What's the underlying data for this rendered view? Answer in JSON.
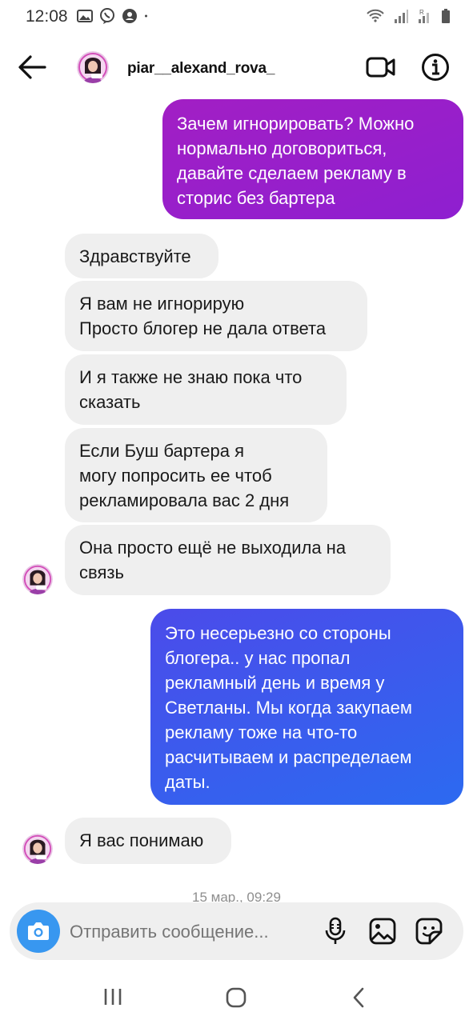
{
  "status_bar": {
    "time": "12:08",
    "left_icons": [
      "gallery-icon",
      "viber-icon",
      "account-icon",
      "dot-icon"
    ],
    "right_icons": [
      "wifi-icon",
      "signal-icon",
      "signal-roaming-icon",
      "battery-icon"
    ]
  },
  "header": {
    "username": "piar__alexand_rova_",
    "icons": [
      "back-arrow-icon",
      "video-call-icon",
      "info-icon"
    ]
  },
  "messages": [
    {
      "from": "me",
      "lines": [
        "Зачем игнорировать? Можно",
        "нормально договориться,",
        "давайте сделаем рекламу в",
        "сторис  без бартера"
      ]
    },
    {
      "from": "them",
      "lines": [
        "Здравствуйте"
      ]
    },
    {
      "from": "them",
      "lines": [
        "Я вам не игнорирую",
        "Просто блогер не дала ответа"
      ]
    },
    {
      "from": "them",
      "lines": [
        "И я также не знаю пока что",
        "сказать"
      ]
    },
    {
      "from": "them",
      "lines": [
        "Если Буш бартера я",
        "могу попросить ее чтоб",
        "рекламировала вас 2 дня"
      ]
    },
    {
      "from": "them",
      "lines": [
        "Она просто ещё не выходила на",
        "связь"
      ]
    },
    {
      "from": "me",
      "lines": [
        "Это несерьезно со стороны",
        "блогера.. у нас пропал",
        "рекламный день и время у",
        "Светланы. Мы когда закупаем",
        "рекламу тоже на что-то",
        "расчитываем и распределаем",
        "даты."
      ]
    },
    {
      "from": "them",
      "lines": [
        "Я вас понимаю"
      ]
    }
  ],
  "date_divider": "15 мар., 09:29",
  "composer": {
    "placeholder": "Отправить сообщение...",
    "icons": [
      "camera-icon",
      "microphone-icon",
      "gallery-icon",
      "sticker-icon"
    ]
  },
  "colors": {
    "outgoing_purple": "#9b1fc9",
    "outgoing_blue": "#3b5bec",
    "incoming_bg": "#efefef",
    "camera_blue": "#3897f0"
  }
}
